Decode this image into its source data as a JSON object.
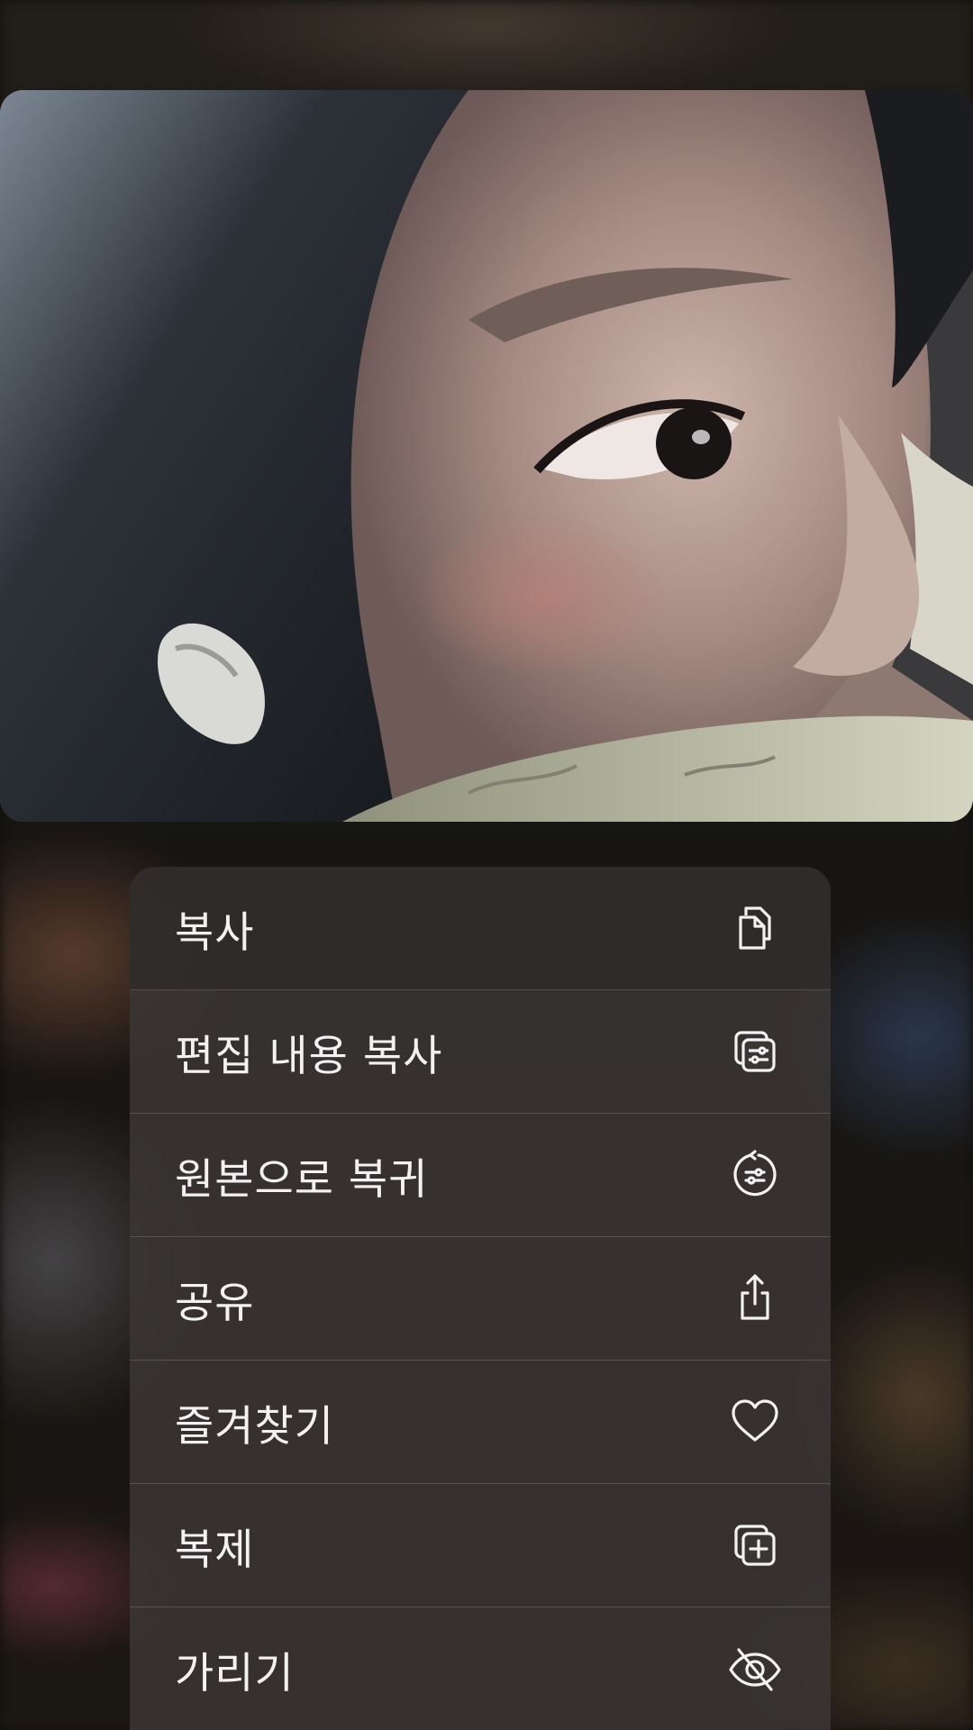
{
  "menu": {
    "items": [
      {
        "label": "복사",
        "icon": "copy-icon"
      },
      {
        "label": "편집 내용 복사",
        "icon": "copy-edits-icon"
      },
      {
        "label": "원본으로 복귀",
        "icon": "revert-to-original-icon"
      },
      {
        "label": "공유",
        "icon": "share-icon"
      },
      {
        "label": "즐겨찾기",
        "icon": "heart-icon"
      },
      {
        "label": "복제",
        "icon": "duplicate-icon"
      },
      {
        "label": "가리기",
        "icon": "hide-eye-slash-icon"
      }
    ]
  },
  "colors": {
    "menu_background": "#3a3634",
    "menu_text": "#f2f2f2",
    "separator": "#5a5654"
  }
}
